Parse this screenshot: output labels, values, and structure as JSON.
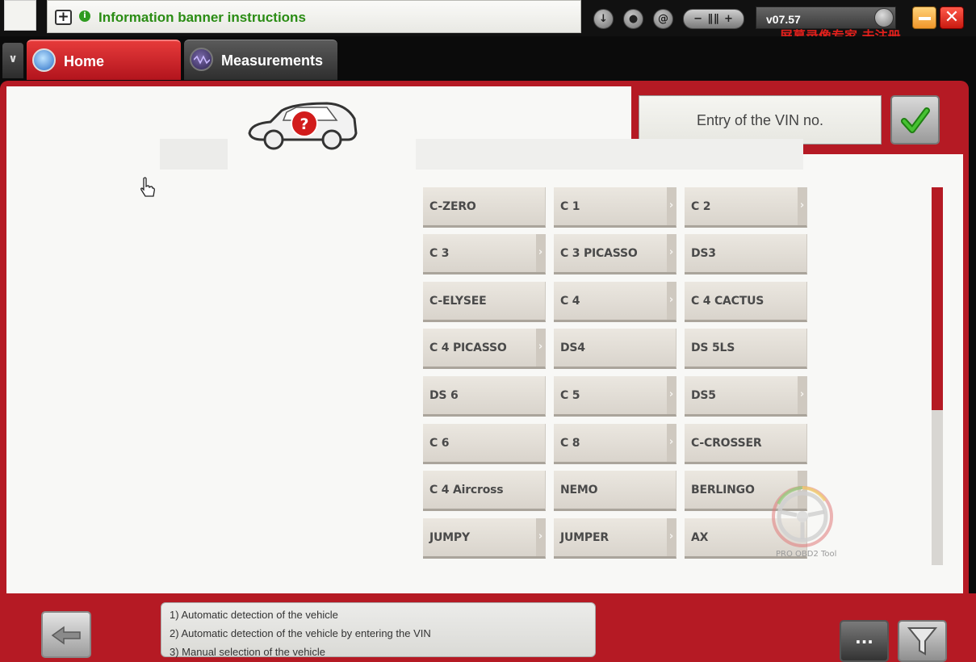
{
  "banner": {
    "text": "Information banner instructions"
  },
  "topbar": {
    "zoom_label": "− ∥∥ +",
    "version": "v07.57",
    "watermark_cn": "屏幕录像专家  未注册",
    "close_glyph": "✕"
  },
  "tabs": {
    "home": "Home",
    "measurements": "Measurements"
  },
  "vin": {
    "label": "Entry of the VIN no."
  },
  "models": [
    {
      "name": "C-ZERO",
      "chevron": false
    },
    {
      "name": "C 1",
      "chevron": true
    },
    {
      "name": "C 2",
      "chevron": true
    },
    {
      "name": "C 3",
      "chevron": true
    },
    {
      "name": "C 3 PICASSO",
      "chevron": true
    },
    {
      "name": "DS3",
      "chevron": false
    },
    {
      "name": "C-ELYSEE",
      "chevron": false
    },
    {
      "name": "C 4",
      "chevron": true
    },
    {
      "name": "C 4 CACTUS",
      "chevron": false
    },
    {
      "name": "C 4 PICASSO",
      "chevron": true
    },
    {
      "name": "DS4",
      "chevron": false
    },
    {
      "name": "DS 5LS",
      "chevron": false
    },
    {
      "name": "DS 6",
      "chevron": false
    },
    {
      "name": "C 5",
      "chevron": true
    },
    {
      "name": "DS5",
      "chevron": true
    },
    {
      "name": "C 6",
      "chevron": false
    },
    {
      "name": "C 8",
      "chevron": true
    },
    {
      "name": "C-CROSSER",
      "chevron": false
    },
    {
      "name": "C 4 Aircross",
      "chevron": false
    },
    {
      "name": "NEMO",
      "chevron": false
    },
    {
      "name": "BERLINGO",
      "chevron": true
    },
    {
      "name": "JUMPY",
      "chevron": true
    },
    {
      "name": "JUMPER",
      "chevron": true
    },
    {
      "name": "AX",
      "chevron": false
    }
  ],
  "scroll": {
    "thumb_fraction": 0.59
  },
  "watermark_logo": {
    "text": "PRO OBD2 Tool"
  },
  "steps": [
    "1) Automatic detection of the vehicle",
    "2) Automatic detection of the vehicle by entering the VIN",
    "3) Manual selection of the vehicle"
  ],
  "bottom": {
    "more_label": "..."
  },
  "colors": {
    "frame_red": "#b51a24",
    "banner_green": "#2a8c14",
    "button_bg": "#e3dfd8"
  }
}
